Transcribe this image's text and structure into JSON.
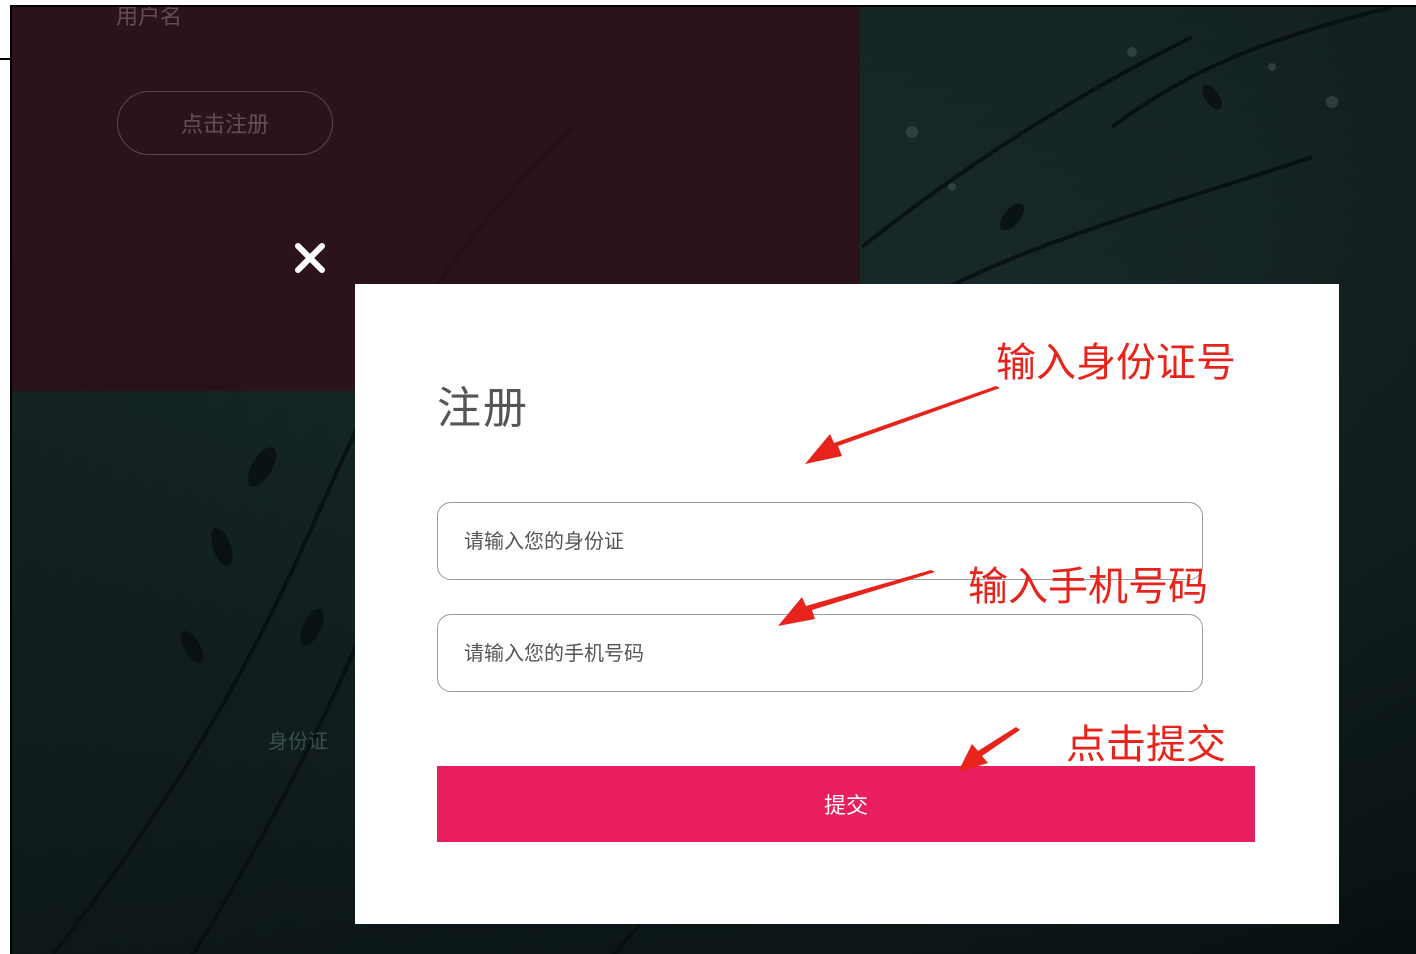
{
  "background": {
    "top_text": "用户名",
    "register_button_label": "点击注册",
    "faint_text": "身份证"
  },
  "modal": {
    "title": "注册",
    "id_field": {
      "placeholder": "请输入您的身份证",
      "value": ""
    },
    "phone_field": {
      "placeholder": "请输入您的手机号码",
      "value": ""
    },
    "submit_label": "提交"
  },
  "annotations": {
    "id_hint": "输入身份证号",
    "phone_hint": "输入手机号码",
    "submit_hint": "点击提交"
  },
  "colors": {
    "accent": "#e81e5e",
    "annotation": "#e8231b",
    "maroon_panel": "#4a1424",
    "background_teal": "#1d3335"
  },
  "icons": {
    "close": "close-icon"
  }
}
